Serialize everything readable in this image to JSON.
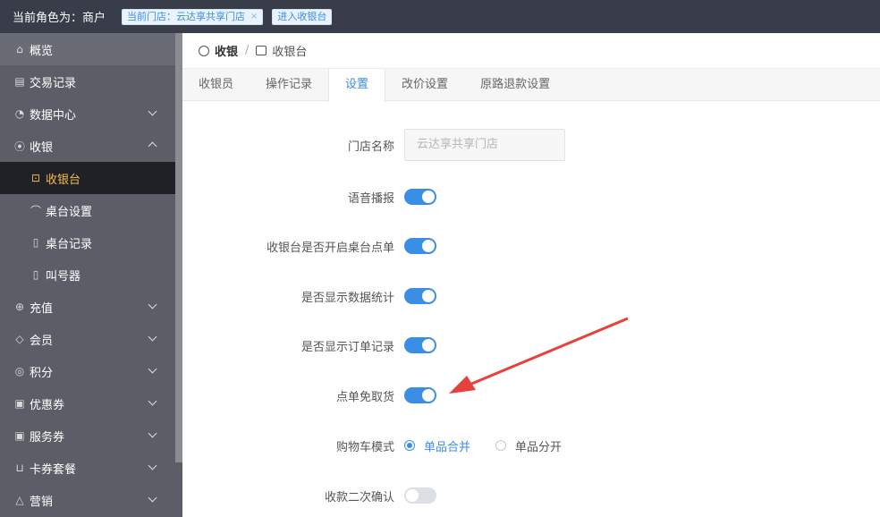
{
  "topbar": {
    "role": "当前角色为：商户",
    "store_tag": "当前门店：云达享共享门店",
    "store_tag_close": "×",
    "enter_cashier": "进入收银台"
  },
  "sidebar": {
    "items": [
      {
        "label": "概览",
        "icon": "home-icon"
      },
      {
        "label": "交易记录",
        "icon": "receipt-icon"
      },
      {
        "label": "数据中心",
        "icon": "pie-chart-icon"
      },
      {
        "label": "收银",
        "icon": "yuan-circle-icon"
      },
      {
        "label": "收银台",
        "icon": "cashier-icon"
      },
      {
        "label": "桌台设置",
        "icon": "table-icon"
      },
      {
        "label": "桌台记录",
        "icon": "document-icon"
      },
      {
        "label": "叫号器",
        "icon": "document-icon"
      },
      {
        "label": "充值",
        "icon": "recharge-icon"
      },
      {
        "label": "会员",
        "icon": "diamond-icon"
      },
      {
        "label": "积分",
        "icon": "coins-icon"
      },
      {
        "label": "优惠券",
        "icon": "ticket-icon"
      },
      {
        "label": "服务券",
        "icon": "ticket-icon"
      },
      {
        "label": "卡券套餐",
        "icon": "bag-icon"
      },
      {
        "label": "营销",
        "icon": "marketing-icon"
      }
    ]
  },
  "breadcrumb": {
    "root": "收银",
    "sep": "/",
    "current": "收银台"
  },
  "tabs": [
    "收银员",
    "操作记录",
    "设置",
    "改价设置",
    "原路退款设置"
  ],
  "form": {
    "store_name_label": "门店名称",
    "store_name_value": "云达享共享门店",
    "voice_label": "语音播报",
    "table_order_label": "收银台是否开启桌台点单",
    "show_stats_label": "是否显示数据统计",
    "show_orders_label": "是否显示订单记录",
    "no_pickup_label": "点单免取货",
    "cart_mode_label": "购物车模式",
    "cart_merge": "单品合并",
    "cart_split": "单品分开",
    "confirm_label": "收款二次确认"
  },
  "colors": {
    "accent": "#3a8ee6",
    "active_menu": "#f5b94a",
    "arrow": "#e8403a"
  }
}
